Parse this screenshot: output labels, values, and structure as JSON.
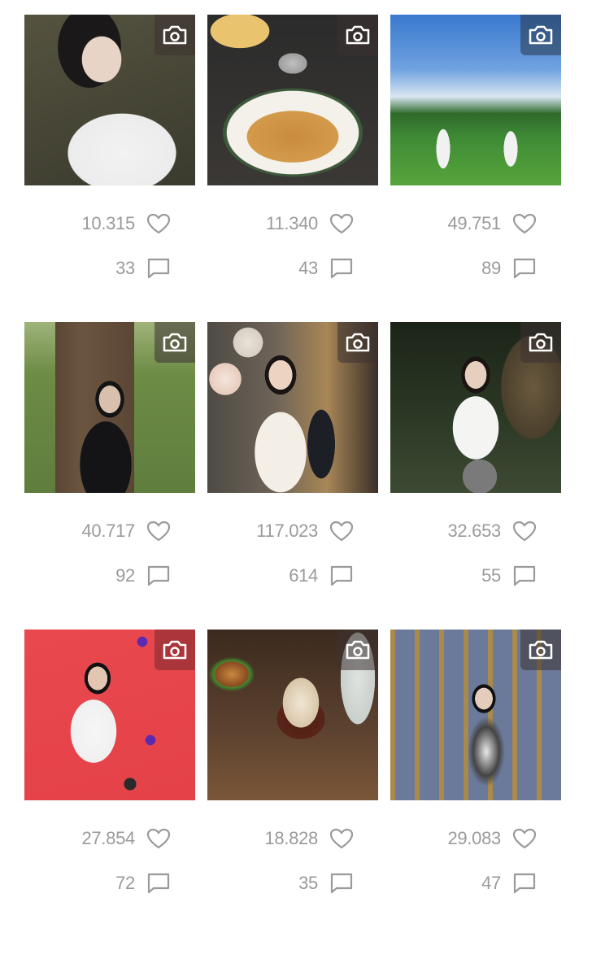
{
  "posts": [
    {
      "likes": "10.315",
      "comments": "33",
      "image": "woman in white varsity sweater by stone wall",
      "bg": "#4b4a3c"
    },
    {
      "likes": "11.340",
      "comments": "43",
      "image": "stack of pancakes with butter cup",
      "bg": "#c89a5b"
    },
    {
      "likes": "49.751",
      "comments": "89",
      "image": "two golfers on green field under blue sky",
      "bg": "#3e8a3a"
    },
    {
      "likes": "40.717",
      "comments": "92",
      "image": "woman in black cardigan sitting by tree",
      "bg": "#4d6b35"
    },
    {
      "likes": "117.023",
      "comments": "614",
      "image": "woman holding flowers with balloons",
      "bg": "#5a4a3e"
    },
    {
      "likes": "32.653",
      "comments": "55",
      "image": "woman in white shirt in garden at night",
      "bg": "#2f3a28"
    },
    {
      "likes": "27.854",
      "comments": "72",
      "image": "tennis player kneeling on red court",
      "bg": "#e0474d"
    },
    {
      "likes": "18.828",
      "comments": "35",
      "image": "burger and glass of wine on table",
      "bg": "#5b3d2a"
    },
    {
      "likes": "29.083",
      "comments": "47",
      "image": "woman in gallery of framed paintings",
      "bg": "#6b7896"
    }
  ],
  "icons": {
    "camera": "camera-icon",
    "like": "heart-icon",
    "comment": "comment-icon"
  },
  "colors": {
    "stat_text": "#9a9a9a",
    "badge": "#3c3232"
  }
}
